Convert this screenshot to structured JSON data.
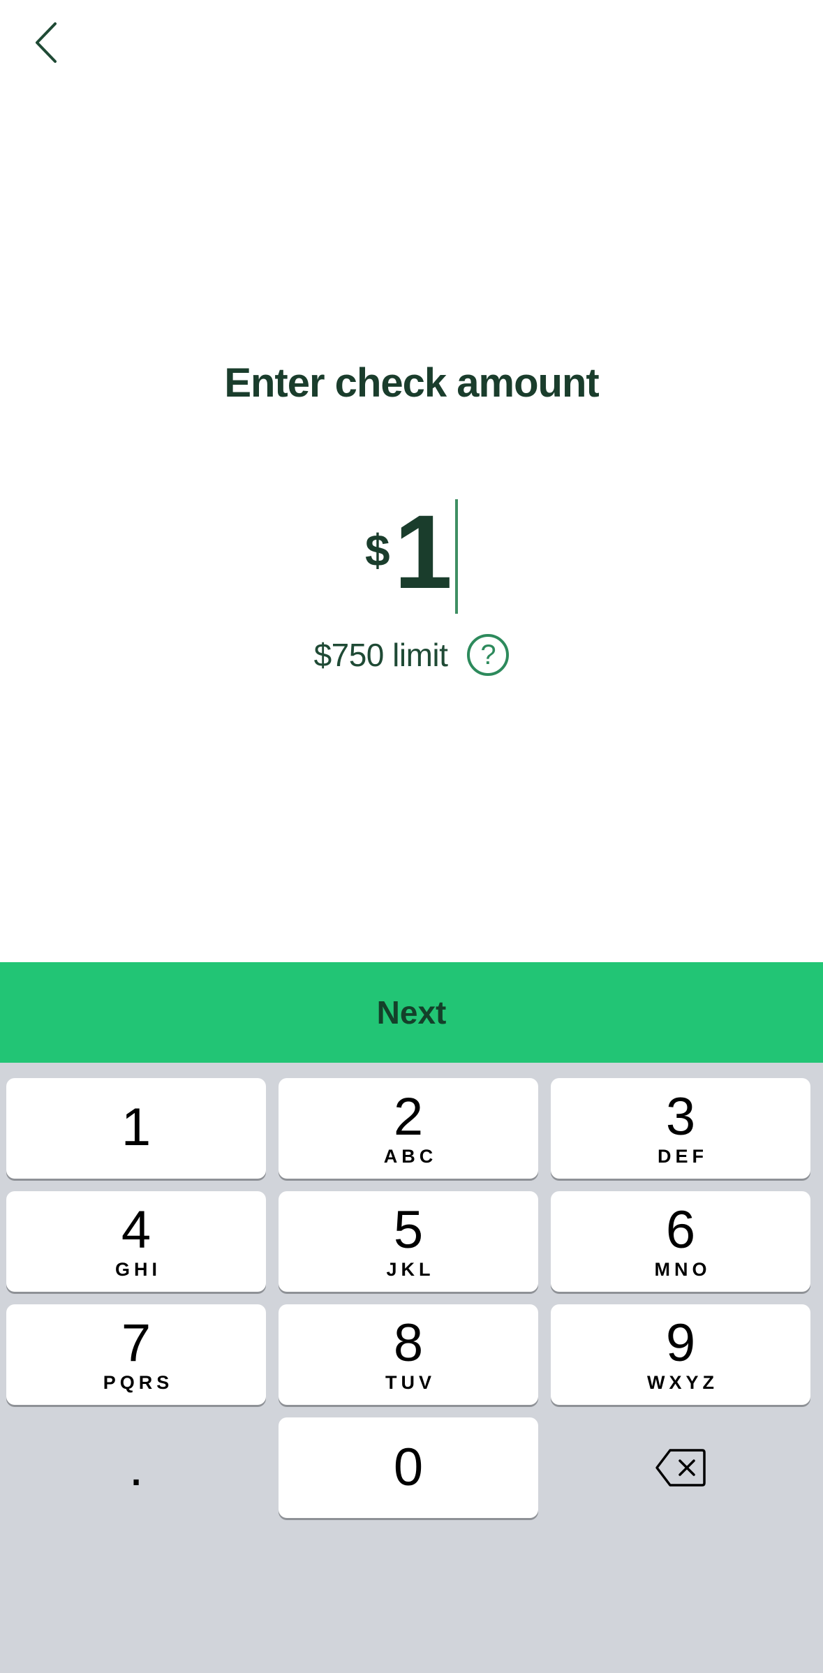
{
  "title": "Enter check amount",
  "amount": {
    "currency_symbol": "$",
    "value": "1"
  },
  "limit_text": "$750 limit",
  "help_label": "?",
  "next_label": "Next",
  "keypad": {
    "keys": [
      {
        "digit": "1",
        "letters": ""
      },
      {
        "digit": "2",
        "letters": "ABC"
      },
      {
        "digit": "3",
        "letters": "DEF"
      },
      {
        "digit": "4",
        "letters": "GHI"
      },
      {
        "digit": "5",
        "letters": "JKL"
      },
      {
        "digit": "6",
        "letters": "MNO"
      },
      {
        "digit": "7",
        "letters": "PQRS"
      },
      {
        "digit": "8",
        "letters": "TUV"
      },
      {
        "digit": "9",
        "letters": "WXYZ"
      },
      {
        "digit": "0",
        "letters": ""
      }
    ],
    "decimal_label": "."
  },
  "colors": {
    "accent_green": "#22c575",
    "text_dark_green": "#1a3d2c",
    "help_green": "#2d8a5c",
    "keyboard_bg": "#d1d4da"
  },
  "icons": {
    "back": "chevron-left-icon",
    "help": "question-circle-icon",
    "delete": "backspace-icon"
  }
}
